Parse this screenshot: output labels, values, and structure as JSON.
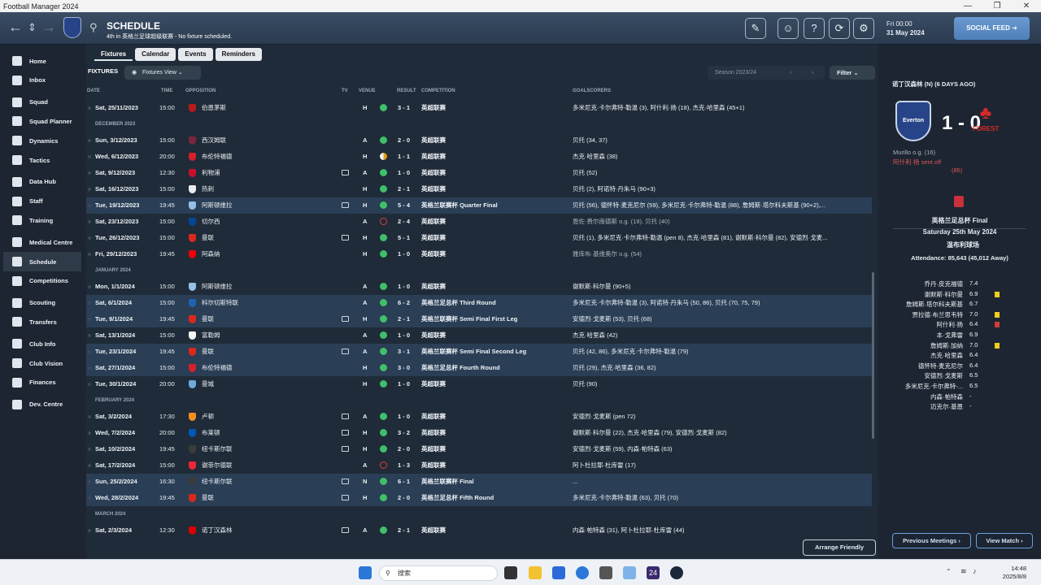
{
  "window": {
    "title": "Football Manager 2024",
    "controls": [
      "—",
      "❐",
      "✕"
    ]
  },
  "topbar": {
    "title": "SCHEDULE",
    "subtitle": "4th in 英格兰足球超级联赛 - No fixture scheduled.",
    "date_line1": "Fri 00:00",
    "date_line2": "31 May 2024",
    "social": "SOCIAL FEED ➔"
  },
  "sidebar": {
    "items": [
      "Home",
      "Inbox",
      "Squad",
      "Squad Planner",
      "Dynamics",
      "Tactics",
      "Data Hub",
      "Staff",
      "Training",
      "Medical Centre",
      "Schedule",
      "Competitions",
      "Scouting",
      "Transfers",
      "Club Info",
      "Club Vision",
      "Finances",
      "Dev. Centre"
    ]
  },
  "tabs": [
    "Fixtures",
    "Calendar",
    "Events",
    "Reminders"
  ],
  "main": {
    "section": "FIXTURES",
    "view": "Fixtures View ⌄",
    "season": "Season 2023/24",
    "filter": "Filter ⌄",
    "arrange": "Arrange Friendly"
  },
  "columns": {
    "date": "DATE",
    "time": "TIME",
    "opposition": "OPPOSITION",
    "tv": "TV",
    "venue": "VENUE",
    "result": "RESULT",
    "competition": "COMPETITION",
    "goalscorers": "GOALSCORERS"
  },
  "fixtures": [
    {
      "date": "Sat, 25/11/2023",
      "time": "15:00",
      "opp": "伯恩茅斯",
      "badge": "#b81b1b",
      "tv": false,
      "venue": "H",
      "outcome": "W",
      "result": "3 - 1",
      "comp": "英超联赛",
      "scorers": "多米尼克·卡尔弗特-勒温 (3), 阿什利·扬 (18), 杰克·哈里森 (45+1)",
      "cup": false
    },
    {
      "month": "DECEMBER 2023"
    },
    {
      "date": "Sun, 3/12/2023",
      "time": "15:00",
      "opp": "西汉姆联",
      "badge": "#7a263a",
      "tv": false,
      "venue": "A",
      "outcome": "W",
      "result": "2 - 0",
      "comp": "英超联赛",
      "scorers": "贝托 (34, 37)",
      "cup": false
    },
    {
      "date": "Wed, 6/12/2023",
      "time": "20:00",
      "opp": "布伦特福德",
      "badge": "#d3202a",
      "tv": false,
      "venue": "H",
      "outcome": "D",
      "result": "1 - 1",
      "comp": "英超联赛",
      "scorers": "杰克·哈里森 (38)",
      "cup": false
    },
    {
      "date": "Sat, 9/12/2023",
      "time": "12:30",
      "opp": "利物浦",
      "badge": "#c8102e",
      "tv": true,
      "venue": "A",
      "outcome": "W",
      "result": "1 - 0",
      "comp": "英超联赛",
      "scorers": "贝托 (52)",
      "cup": false
    },
    {
      "date": "Sat, 16/12/2023",
      "time": "15:00",
      "opp": "热刺",
      "badge": "#e8ecf2",
      "tv": false,
      "venue": "H",
      "outcome": "W",
      "result": "2 - 1",
      "comp": "英超联赛",
      "scorers": "贝托 (2), 阿诺特·丹朱马 (90+3)",
      "cup": false
    },
    {
      "date": "Tue, 19/12/2023",
      "time": "19:45",
      "opp": "阿斯顿维拉",
      "badge": "#95bfe5",
      "tv": true,
      "venue": "H",
      "outcome": "W",
      "result": "5 - 4",
      "comp": "英格兰联赛杯 Quarter Final",
      "scorers": "贝托 (56), 德怀特·麦克尼尔 (59), 多米尼克·卡尔弗特-勒温 (88), 詹姆斯·塔尔科夫斯基 (90+2),...",
      "cup": true
    },
    {
      "date": "Sat, 23/12/2023",
      "time": "15:00",
      "opp": "切尔西",
      "badge": "#034694",
      "tv": false,
      "venue": "A",
      "outcome": "L",
      "result": "2 - 4",
      "comp": "英超联赛",
      "scorers": "恩佐·费尔南德斯 o.g. (18), 贝托 (40)",
      "cup": false
    },
    {
      "date": "Tue, 26/12/2023",
      "time": "15:00",
      "opp": "曼联",
      "badge": "#da291c",
      "tv": true,
      "venue": "H",
      "outcome": "W",
      "result": "5 - 1",
      "comp": "英超联赛",
      "scorers": "贝托 (1), 多米尼克·卡尔弗特-勒温 (pen 8), 杰克·哈里森 (81), 谢默斯·科尔曼 (82), 安德烈·戈麦...",
      "cup": false
    },
    {
      "date": "Fri, 29/12/2023",
      "time": "19:45",
      "opp": "阿森纳",
      "badge": "#ef0107",
      "tv": false,
      "venue": "H",
      "outcome": "W",
      "result": "1 - 0",
      "comp": "英超联赛",
      "scorers": "雅库布·基维奥尔 o.g. (54)",
      "cup": false
    },
    {
      "month": "JANUARY 2024"
    },
    {
      "date": "Mon, 1/1/2024",
      "time": "15:00",
      "opp": "阿斯顿维拉",
      "badge": "#95bfe5",
      "tv": false,
      "venue": "A",
      "outcome": "W",
      "result": "1 - 0",
      "comp": "英超联赛",
      "scorers": "谢默斯·科尔曼 (90+5)",
      "cup": false
    },
    {
      "date": "Sat, 6/1/2024",
      "time": "15:00",
      "opp": "科尔切斯特联",
      "badge": "#1e64b5",
      "tv": false,
      "venue": "A",
      "outcome": "W",
      "result": "6 - 2",
      "comp": "英格兰足总杯 Third Round",
      "scorers": "多米尼克·卡尔弗特-勒温 (3), 阿诺特·丹朱马 (50, 86), 贝托 (70, 75, 79)",
      "cup": true
    },
    {
      "date": "Tue, 9/1/2024",
      "time": "19:45",
      "opp": "曼联",
      "badge": "#da291c",
      "tv": true,
      "venue": "H",
      "outcome": "W",
      "result": "2 - 1",
      "comp": "英格兰联赛杯 Semi Final First Leg",
      "scorers": "安德烈·戈麦斯 (53), 贝托 (68)",
      "cup": true
    },
    {
      "date": "Sat, 13/1/2024",
      "time": "15:00",
      "opp": "富勒姆",
      "badge": "#f5f5f5",
      "tv": false,
      "venue": "A",
      "outcome": "W",
      "result": "1 - 0",
      "comp": "英超联赛",
      "scorers": "杰克·哈里森 (42)",
      "cup": false
    },
    {
      "date": "Tue, 23/1/2024",
      "time": "19:45",
      "opp": "曼联",
      "badge": "#da291c",
      "tv": true,
      "venue": "A",
      "outcome": "W",
      "result": "3 - 1",
      "comp": "英格兰联赛杯 Semi Final Second Leg",
      "scorers": "贝托 (42, 86), 多米尼克·卡尔弗特-勒温 (79)",
      "cup": true
    },
    {
      "date": "Sat, 27/1/2024",
      "time": "15:00",
      "opp": "布伦特福德",
      "badge": "#d3202a",
      "tv": false,
      "venue": "H",
      "outcome": "W",
      "result": "3 - 0",
      "comp": "英格兰足总杯 Fourth Round",
      "scorers": "贝托 (29), 杰克·哈里森 (36, 82)",
      "cup": true
    },
    {
      "date": "Tue, 30/1/2024",
      "time": "20:00",
      "opp": "曼城",
      "badge": "#6cabdd",
      "tv": false,
      "venue": "H",
      "outcome": "W",
      "result": "1 - 0",
      "comp": "英超联赛",
      "scorers": "贝托 (90)",
      "cup": false
    },
    {
      "month": "FEBRUARY 2024"
    },
    {
      "date": "Sat, 3/2/2024",
      "time": "17:30",
      "opp": "卢顿",
      "badge": "#f78f1e",
      "tv": true,
      "venue": "A",
      "outcome": "W",
      "result": "1 - 0",
      "comp": "英超联赛",
      "scorers": "安德烈·戈麦斯 (pen 72)",
      "cup": false
    },
    {
      "date": "Wed, 7/2/2024",
      "time": "20:00",
      "opp": "布莱顿",
      "badge": "#0057b8",
      "tv": true,
      "venue": "H",
      "outcome": "W",
      "result": "3 - 2",
      "comp": "英超联赛",
      "scorers": "谢默斯·科尔曼 (22), 杰克·哈里森 (79), 安德烈·戈麦斯 (82)",
      "cup": false
    },
    {
      "date": "Sat, 10/2/2024",
      "time": "19:45",
      "opp": "纽卡斯尔联",
      "badge": "#3c3c3c",
      "tv": true,
      "venue": "H",
      "outcome": "W",
      "result": "2 - 0",
      "comp": "英超联赛",
      "scorers": "安德烈·戈麦斯 (59), 内森·帕特森 (63)",
      "cup": false
    },
    {
      "date": "Sat, 17/2/2024",
      "time": "15:00",
      "opp": "谢菲尔德联",
      "badge": "#ee2737",
      "tv": false,
      "venue": "A",
      "outcome": "L",
      "result": "1 - 3",
      "comp": "英超联赛",
      "scorers": "阿卜杜拉耶·杜库雷 (17)",
      "cup": false
    },
    {
      "date": "Sun, 25/2/2024",
      "time": "16:30",
      "opp": "纽卡斯尔联",
      "badge": "#3c3c3c",
      "tv": true,
      "venue": "N",
      "outcome": "W",
      "result": "6 - 1",
      "comp": "英格兰联赛杯 Final",
      "scorers": "...",
      "cup": true
    },
    {
      "date": "Wed, 28/2/2024",
      "time": "19:45",
      "opp": "曼联",
      "badge": "#da291c",
      "tv": true,
      "venue": "H",
      "outcome": "W",
      "result": "2 - 0",
      "comp": "英格兰足总杯 Fifth Round",
      "scorers": "多米尼克·卡尔弗特-勒温 (63), 贝托 (70)",
      "cup": true
    },
    {
      "month": "MARCH 2024"
    },
    {
      "date": "Sat, 2/3/2024",
      "time": "12:30",
      "opp": "诺丁汉森林",
      "badge": "#dd0000",
      "tv": true,
      "venue": "A",
      "outcome": "W",
      "result": "2 - 1",
      "comp": "英超联赛",
      "scorers": "内森·帕特森 (31), 阿卜杜拉耶·杜库雷 (44)",
      "cup": false
    }
  ],
  "match": {
    "header": "诺丁汉森林 (N) (6 DAYS AGO)",
    "home_badge": "Everton",
    "away_badge": "FOREST",
    "score": "1 - 0",
    "events": [
      "Murillo o.g. (16)",
      "阿什利·扬 sent off",
      "(85)"
    ],
    "competition": "英格兰足总杯 Final",
    "date": "Saturday 25th May 2024",
    "venue": "温布利球场",
    "attendance": "Attendance: 85,643 (45,012 Away)",
    "players": [
      {
        "name": "乔丹·皮克福德",
        "rating": "7.4",
        "card": ""
      },
      {
        "name": "谢默斯·科尔曼",
        "rating": "6.9",
        "card": "yellow"
      },
      {
        "name": "詹姆斯·塔尔科夫斯基",
        "rating": "6.7",
        "card": ""
      },
      {
        "name": "贾拉德·布兰思韦特",
        "rating": "7.0",
        "card": "yellow"
      },
      {
        "name": "阿什利·扬",
        "rating": "6.4",
        "card": "red"
      },
      {
        "name": "本·戈弗雷",
        "rating": "6.9",
        "card": ""
      },
      {
        "name": "詹姆斯·加纳",
        "rating": "7.0",
        "card": "yellow"
      },
      {
        "name": "杰克·哈里森",
        "rating": "6.4",
        "card": ""
      },
      {
        "name": "德怀特·麦克尼尔",
        "rating": "6.4",
        "card": ""
      },
      {
        "name": "安德烈·戈麦斯",
        "rating": "6.5",
        "card": ""
      },
      {
        "name": "多米尼克·卡尔弗特-...",
        "rating": "6.5",
        "card": ""
      },
      {
        "name": "内森·帕特森",
        "rating": "-",
        "card": ""
      },
      {
        "name": "迈克尔·基恩",
        "rating": "-",
        "card": ""
      }
    ],
    "btn_prev": "Previous Meetings ›",
    "btn_view": "View Match ›"
  },
  "taskbar": {
    "search": "搜索",
    "time": "14:48",
    "date": "2025/8/8"
  },
  "colors": {
    "win": "#3fbf6a",
    "loss": "#e23b3b",
    "accent": "#4f7fb7"
  }
}
